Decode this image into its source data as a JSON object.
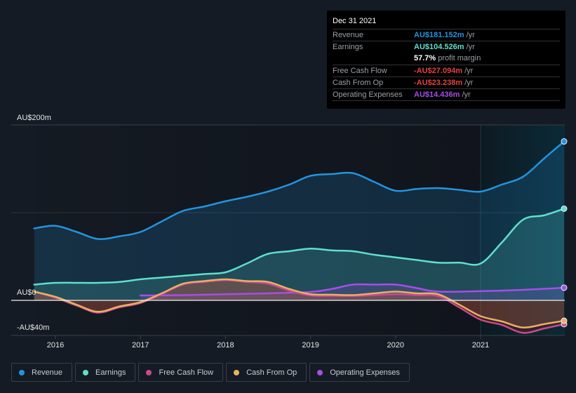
{
  "tooltip": {
    "date": "Dec 31 2021",
    "rows": [
      {
        "label": "Revenue",
        "value": "AU$181.152m",
        "unit": "/yr",
        "color": "#2394df"
      },
      {
        "label": "Earnings",
        "value": "AU$104.526m",
        "unit": "/yr",
        "color": "#5ee0cb"
      },
      {
        "label": "",
        "value": "57.7%",
        "unit": "profit margin",
        "color": "#ffffff"
      },
      {
        "label": "Free Cash Flow",
        "value": "-AU$27.094m",
        "unit": "/yr",
        "color": "#e64141"
      },
      {
        "label": "Cash From Op",
        "value": "-AU$23.238m",
        "unit": "/yr",
        "color": "#e64141"
      },
      {
        "label": "Operating Expenses",
        "value": "AU$14.436m",
        "unit": "/yr",
        "color": "#a64ee8"
      }
    ]
  },
  "legend": [
    {
      "label": "Revenue",
      "color": "#2394df"
    },
    {
      "label": "Earnings",
      "color": "#5ee0cb"
    },
    {
      "label": "Free Cash Flow",
      "color": "#c94a8c"
    },
    {
      "label": "Cash From Op",
      "color": "#e9b062"
    },
    {
      "label": "Operating Expenses",
      "color": "#a64ee8"
    }
  ],
  "chart_data": {
    "type": "area",
    "title": "",
    "xlabel": "",
    "ylabel": "",
    "y_unit": "AU$ millions",
    "ylim": [
      -40,
      200
    ],
    "xlim": [
      2015.75,
      2021.0
    ],
    "y_tick_labels": [
      {
        "value": 200,
        "label": "AU$200m"
      },
      {
        "value": 0,
        "label": "AU$0"
      },
      {
        "value": -40,
        "label": "-AU$40m"
      }
    ],
    "x_tick_labels": [
      {
        "value": 2016,
        "label": "2016"
      },
      {
        "value": 2017,
        "label": "2017"
      },
      {
        "value": 2018,
        "label": "2018"
      },
      {
        "value": 2019,
        "label": "2019"
      },
      {
        "value": 2020,
        "label": "2020"
      },
      {
        "value": 2021,
        "label": "2021"
      }
    ],
    "highlight_from": 2021.0,
    "series": [
      {
        "name": "Revenue",
        "color": "#2394df",
        "x": [
          2015.75,
          2016.0,
          2016.25,
          2016.5,
          2016.75,
          2017.0,
          2017.25,
          2017.5,
          2017.75,
          2018.0,
          2018.25,
          2018.5,
          2018.75,
          2019.0,
          2019.25,
          2019.5,
          2019.75,
          2020.0,
          2020.25,
          2020.5,
          2020.75,
          2021.0,
          2021.25,
          2021.5,
          2021.75,
          2022.0
        ],
        "values": [
          82,
          85,
          78,
          70,
          73,
          78,
          90,
          102,
          107,
          113,
          118,
          124,
          132,
          142,
          144,
          145,
          135,
          125,
          127,
          128,
          126,
          124,
          132,
          141,
          162,
          181.152
        ]
      },
      {
        "name": "Earnings",
        "color": "#5ee0cb",
        "x": [
          2015.75,
          2016.0,
          2016.25,
          2016.5,
          2016.75,
          2017.0,
          2017.25,
          2017.5,
          2017.75,
          2018.0,
          2018.25,
          2018.5,
          2018.75,
          2019.0,
          2019.25,
          2019.5,
          2019.75,
          2020.0,
          2020.25,
          2020.5,
          2020.75,
          2021.0,
          2021.25,
          2021.5,
          2021.75,
          2022.0
        ],
        "values": [
          18,
          20,
          20,
          20,
          21,
          24,
          26,
          28,
          30,
          32,
          42,
          53,
          56,
          59,
          57,
          56,
          52,
          49,
          46,
          43,
          43,
          42,
          66,
          92,
          97,
          104.526
        ]
      },
      {
        "name": "Free Cash Flow",
        "color": "#c94a8c",
        "x": [
          2015.75,
          2016.0,
          2016.25,
          2016.5,
          2016.75,
          2017.0,
          2017.25,
          2017.5,
          2017.75,
          2018.0,
          2018.25,
          2018.5,
          2018.75,
          2019.0,
          2019.25,
          2019.5,
          2019.75,
          2020.0,
          2020.25,
          2020.5,
          2020.75,
          2021.0,
          2021.25,
          2021.5,
          2021.75,
          2022.0
        ],
        "values": [
          10,
          3,
          -6,
          -14,
          -8,
          -3,
          7,
          18,
          21,
          23,
          21,
          19,
          11,
          5.6,
          5.2,
          5,
          6,
          7,
          6,
          5,
          -8,
          -22,
          -28,
          -37,
          -32,
          -27.094
        ]
      },
      {
        "name": "Cash From Op",
        "color": "#e9b062",
        "x": [
          2015.75,
          2016.0,
          2016.25,
          2016.5,
          2016.75,
          2017.0,
          2017.25,
          2017.5,
          2017.75,
          2018.0,
          2018.25,
          2018.5,
          2018.75,
          2019.0,
          2019.25,
          2019.5,
          2019.75,
          2020.0,
          2020.25,
          2020.5,
          2020.75,
          2021.0,
          2021.25,
          2021.5,
          2021.75,
          2022.0
        ],
        "values": [
          10,
          4,
          -5,
          -13,
          -7,
          -2,
          8,
          19,
          22,
          24,
          22,
          21,
          13,
          7,
          6.5,
          6,
          8,
          10,
          8,
          7,
          -5,
          -18,
          -24,
          -31,
          -27,
          -23.238
        ]
      },
      {
        "name": "Operating Expenses",
        "color": "#a64ee8",
        "x": [
          2017.0,
          2017.5,
          2018.0,
          2018.5,
          2019.0,
          2019.25,
          2019.5,
          2019.75,
          2020.0,
          2020.25,
          2020.5,
          2021.0,
          2021.5,
          2022.0
        ],
        "values": [
          5.6,
          6,
          7,
          8,
          9.6,
          13,
          18,
          18,
          18,
          14,
          10,
          10.5,
          12,
          14.436
        ]
      }
    ]
  }
}
